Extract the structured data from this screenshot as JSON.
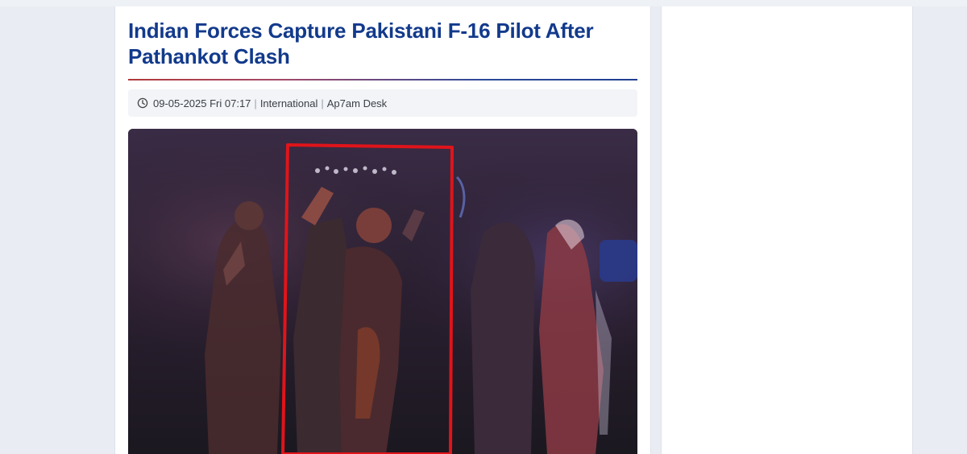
{
  "article": {
    "title": "Indian Forces Capture Pakistani F-16 Pilot After Pathankot Clash",
    "meta": {
      "date": "09-05-2025 Fri 07:17",
      "category": "International",
      "author": "Ap7am Desk",
      "separator": "|"
    },
    "image": {
      "icon": "photo",
      "highlight_color": "#e0141a"
    }
  },
  "colors": {
    "headline": "#123a8c",
    "page_bg": "#e9edf3"
  }
}
